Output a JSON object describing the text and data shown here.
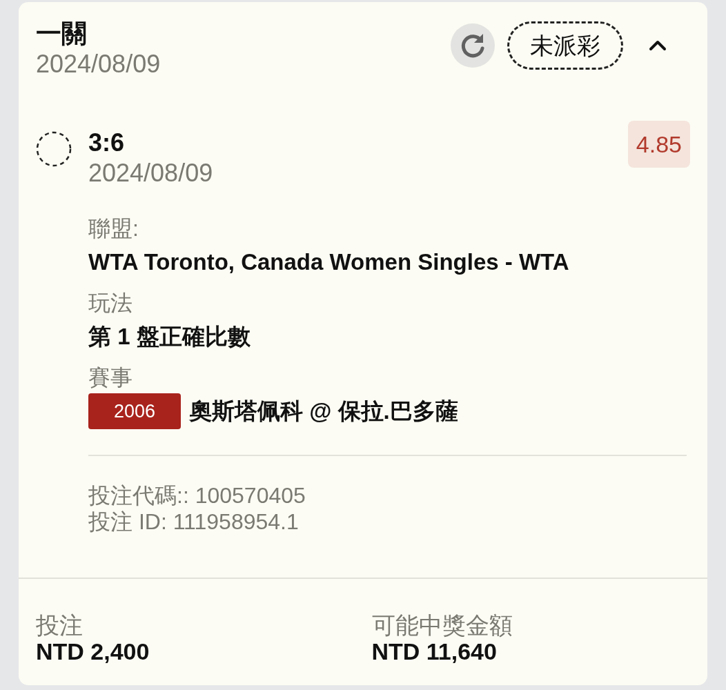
{
  "bet": {
    "title": "一關",
    "date": "2024/08/09",
    "status": "未派彩",
    "expanded": true
  },
  "selection": {
    "pick": "3:6",
    "date": "2024/08/09",
    "odds": "4.85"
  },
  "details": [
    {
      "label": "聯盟:",
      "value": "WTA Toronto, Canada Women Singles - WTA"
    },
    {
      "label": "玩法",
      "value": "第 1 盤正確比數"
    },
    {
      "label": "賽事",
      "value": "奧斯塔佩科 @ 保拉.巴多薩",
      "code": "2006"
    }
  ],
  "bet_codes": [
    "投注代碼:: 100570405",
    "投注 ID: 111958954.1"
  ],
  "footer": [
    {
      "label": "投注",
      "value": "NTD 2,400"
    },
    {
      "label": "可能中獎金額",
      "value": "NTD 11,640"
    }
  ]
}
